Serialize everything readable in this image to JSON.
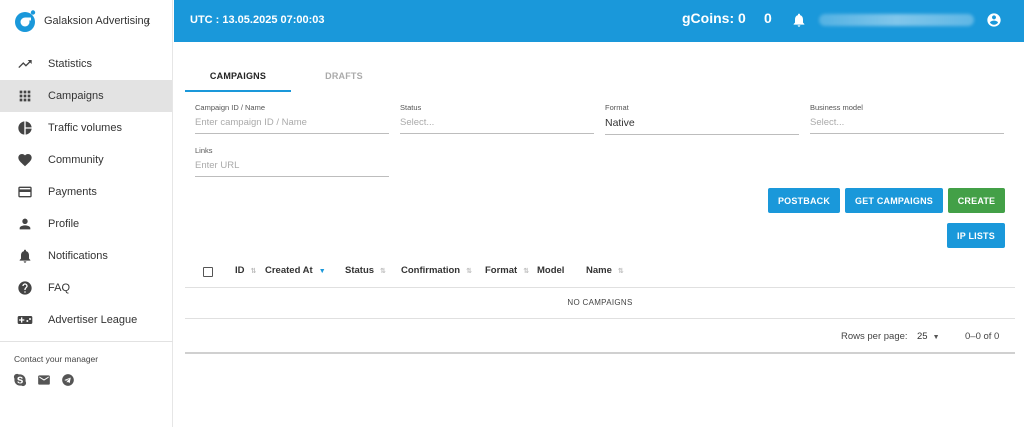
{
  "brand": {
    "name": "Galaksion Advertising",
    "collapse_icon": "chevron-left-icon"
  },
  "nav": [
    {
      "label": "Statistics",
      "icon": "trending-up-icon"
    },
    {
      "label": "Campaigns",
      "icon": "grid-icon",
      "active": true
    },
    {
      "label": "Traffic volumes",
      "icon": "pie-chart-icon"
    },
    {
      "label": "Community",
      "icon": "heart-icon"
    },
    {
      "label": "Payments",
      "icon": "credit-card-icon"
    },
    {
      "label": "Profile",
      "icon": "person-icon"
    },
    {
      "label": "Notifications",
      "icon": "bell-icon"
    },
    {
      "label": "FAQ",
      "icon": "help-icon"
    },
    {
      "label": "Advertiser League",
      "icon": "gamepad-icon"
    }
  ],
  "contact": {
    "title": "Contact your manager",
    "icons": [
      "skype-icon",
      "email-icon",
      "telegram-icon"
    ]
  },
  "header": {
    "utc": "UTC : 13.05.2025 07:00:03",
    "gcoins": "gCoins: 0",
    "notifications_count": "0"
  },
  "tabs": [
    {
      "label": "CAMPAIGNS",
      "active": true
    },
    {
      "label": "DRAFTS",
      "active": false
    }
  ],
  "filters": {
    "campaign": {
      "label": "Campaign ID / Name",
      "placeholder": "Enter campaign ID / Name",
      "value": ""
    },
    "status": {
      "label": "Status",
      "placeholder": "Select...",
      "value": ""
    },
    "format": {
      "label": "Format",
      "value": "Native"
    },
    "business_model": {
      "label": "Business model",
      "placeholder": "Select...",
      "value": ""
    },
    "links": {
      "label": "Links",
      "placeholder": "Enter URL",
      "value": ""
    }
  },
  "buttons": {
    "postback": "POSTBACK",
    "get_campaigns": "GET CAMPAIGNS",
    "create": "CREATE",
    "ip_lists": "IP LISTS"
  },
  "table": {
    "columns": [
      "ID",
      "Created At",
      "Status",
      "Confirmation",
      "Format",
      "Model",
      "Name"
    ],
    "empty_text": "NO CAMPAIGNS",
    "rows_per_page_label": "Rows per page:",
    "rows_per_page": "25",
    "range": "0–0 of 0"
  },
  "colors": {
    "primary": "#1a98da",
    "create": "#43a047"
  }
}
